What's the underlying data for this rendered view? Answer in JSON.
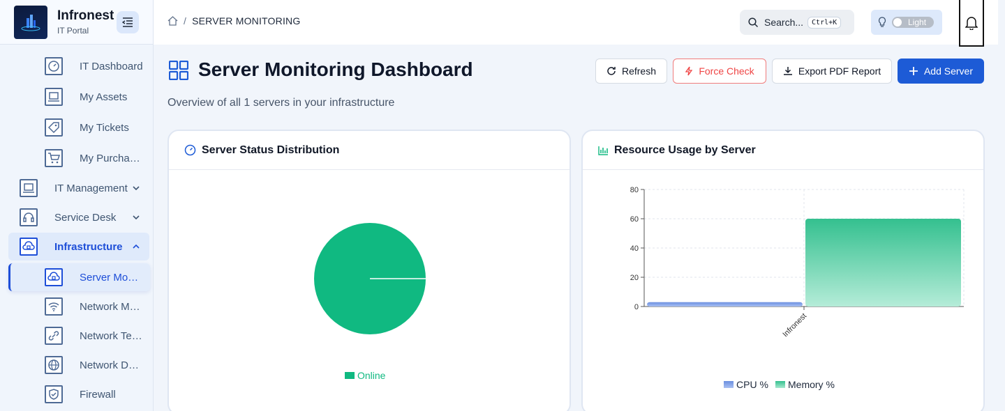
{
  "brand": {
    "name": "Infronest",
    "subtitle": "IT Portal"
  },
  "sidebar": {
    "items": [
      {
        "label": "IT Dashboard",
        "icon": "gauge-icon"
      },
      {
        "label": "My Assets",
        "icon": "laptop-icon"
      },
      {
        "label": "My Tickets",
        "icon": "tag-icon"
      },
      {
        "label": "My Purcha…",
        "icon": "cart-icon"
      },
      {
        "label": "IT Management",
        "icon": "laptop-icon"
      },
      {
        "label": "Service Desk",
        "icon": "headset-icon"
      },
      {
        "label": "Infrastructure",
        "icon": "cloud-server-icon"
      },
      {
        "label": "Server Mo…",
        "icon": "cloud-server-icon"
      },
      {
        "label": "Network M…",
        "icon": "wifi-icon"
      },
      {
        "label": "Network Te…",
        "icon": "link-icon"
      },
      {
        "label": "Network D…",
        "icon": "globe-icon"
      },
      {
        "label": "Firewall",
        "icon": "shield-icon"
      }
    ]
  },
  "header": {
    "breadcrumb": "SERVER MONITORING",
    "search_placeholder": "Search...",
    "search_shortcut": "Ctrl+K",
    "theme_label": "Light"
  },
  "page": {
    "title": "Server Monitoring Dashboard",
    "subtitle": "Overview of all 1 servers in your infrastructure",
    "buttons": {
      "refresh": "Refresh",
      "force_check": "Force Check",
      "export": "Export PDF Report",
      "add": "Add Server"
    }
  },
  "cards": {
    "status": {
      "title": "Server Status Distribution",
      "legend": "Online"
    },
    "resource": {
      "title": "Resource Usage by Server"
    }
  },
  "colors": {
    "primary": "#1d5bd6",
    "online": "#10b981",
    "cpu": "#6b8fe0",
    "memory": "#34c08f",
    "danger": "#ef4444"
  },
  "chart_data": [
    {
      "type": "pie",
      "categories": [
        "Online"
      ],
      "values": [
        1
      ]
    },
    {
      "type": "bar",
      "categories": [
        "Infronest"
      ],
      "series": [
        {
          "name": "CPU %",
          "values": [
            3
          ]
        },
        {
          "name": "Memory %",
          "values": [
            60
          ]
        }
      ],
      "ylim": [
        0,
        80
      ],
      "yticks": [
        "0",
        "20",
        "40",
        "60",
        "80"
      ]
    }
  ]
}
